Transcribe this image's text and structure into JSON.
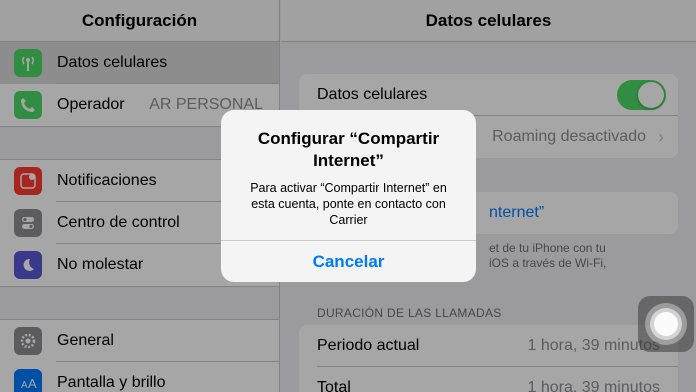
{
  "sidebar": {
    "title": "Configuración",
    "groups": [
      {
        "items": [
          {
            "label": "Datos celulares",
            "icon": "antenna-icon",
            "color": "#4cd964",
            "selected": true
          },
          {
            "label": "Operador",
            "detail": "AR PERSONAL",
            "icon": "phone-icon",
            "color": "#4cd964"
          }
        ]
      },
      {
        "items": [
          {
            "label": "Notificaciones",
            "icon": "notifications-icon",
            "color": "#ff3b30"
          },
          {
            "label": "Centro de control",
            "icon": "control-center-icon",
            "color": "#8e8e93"
          },
          {
            "label": "No molestar",
            "icon": "moon-icon",
            "color": "#5856d6"
          }
        ]
      },
      {
        "items": [
          {
            "label": "General",
            "icon": "gear-icon",
            "color": "#8e8e93"
          },
          {
            "label": "Pantalla y brillo",
            "icon": "display-brightness-icon",
            "color": "#007aff"
          }
        ]
      }
    ]
  },
  "detail": {
    "title": "Datos celulares",
    "cellular_data_label": "Datos celulares",
    "cellular_data_on": true,
    "roaming_value": "Roaming desactivado",
    "hotspot_link": "nternet”",
    "hotspot_footnote": [
      "et de tu iPhone con tu",
      "iOS a través de Wi-Fi,"
    ],
    "call_duration_header": "DURACIÓN DE LAS LLAMADAS",
    "current_period_label": "Periodo actual",
    "current_period_value": "1 hora, 39 minutos",
    "total_label": "Total",
    "total_value": "1 hora, 39 minutos"
  },
  "alert": {
    "title": "Configurar “Compartir Internet”",
    "message": "Para activar “Compartir Internet” en esta cuenta, ponte en contacto con Carrier",
    "cancel": "Cancelar"
  },
  "colors": {
    "accent": "#007aff",
    "toggle_on": "#4cd964"
  }
}
